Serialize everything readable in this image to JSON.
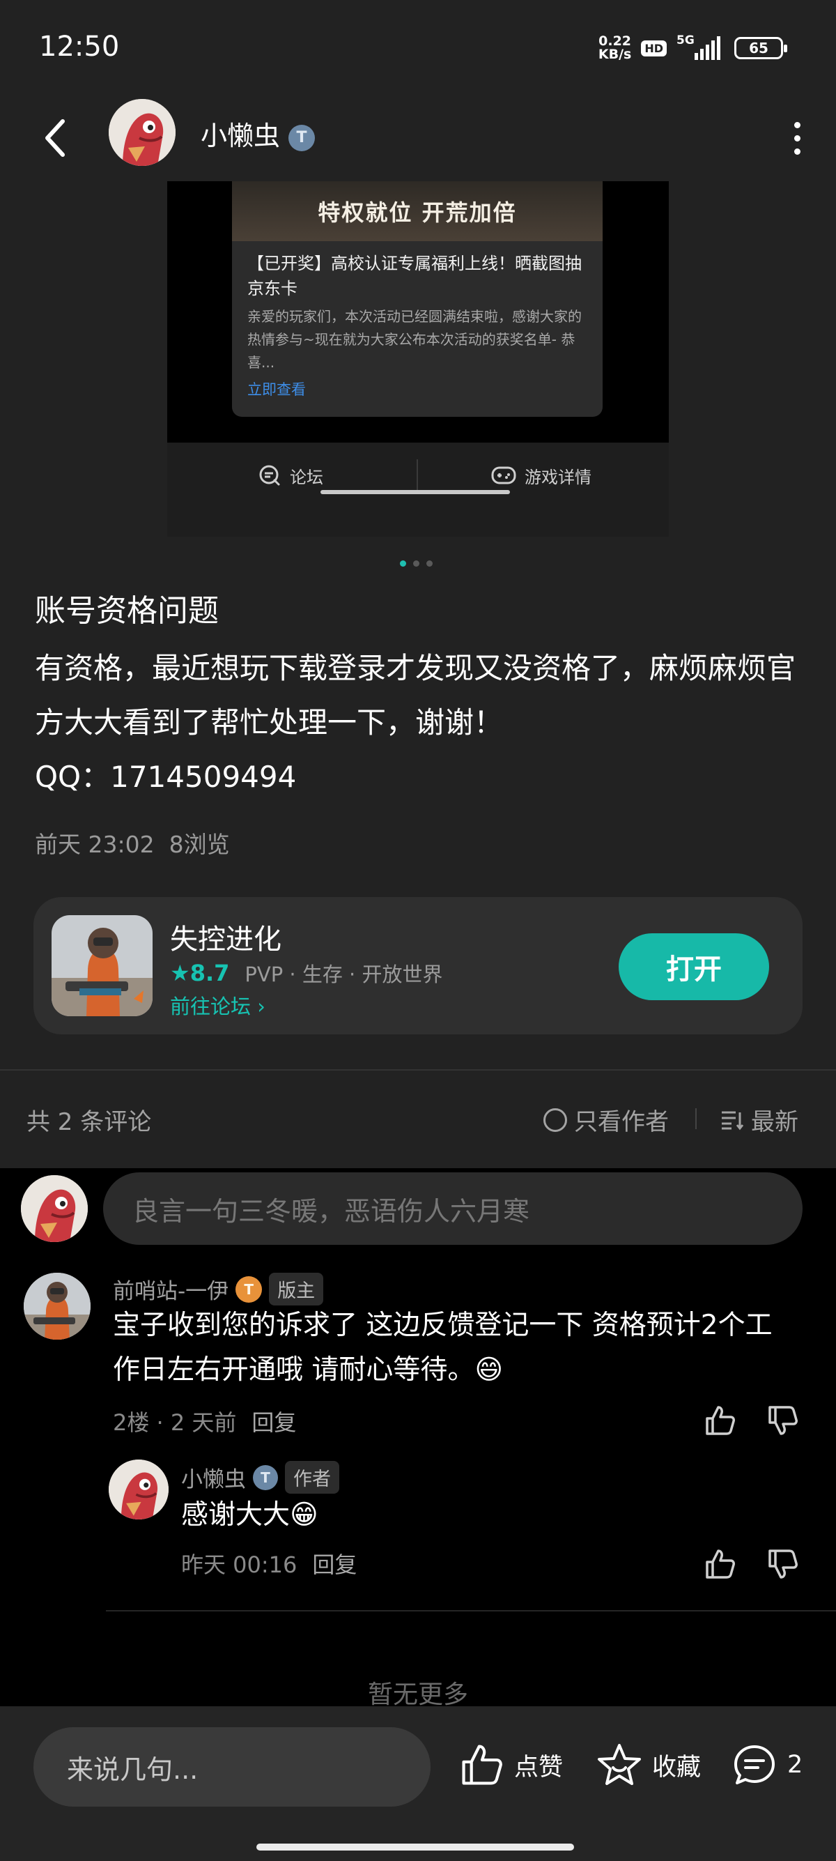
{
  "status_bar": {
    "time": "12:50",
    "net_speed_value": "0.22",
    "net_speed_unit": "KB/s",
    "hd": "HD",
    "network": "5G",
    "battery": "65"
  },
  "header": {
    "username": "小懒虫",
    "verify_badge": "T"
  },
  "post_image": {
    "banner_text": "特权就位 开荒加倍",
    "card_title": "【已开奖】高校认证专属福利上线！晒截图抽京东卡",
    "card_body": "亲爱的玩家们，本次活动已经圆满结束啦，感谢大家的热情参与~现在就为大家公布本次活动的获奖名单- 恭喜...",
    "card_link": "立即查看",
    "tab_forum": "论坛",
    "tab_game_detail": "游戏详情"
  },
  "post": {
    "title": "账号资格问题",
    "body": "有资格，最近想玩下载登录才发现又没资格了，麻烦麻烦官方大大看到了帮忙处理一下，谢谢！",
    "qq": "QQ：1714509494",
    "time": "前天 23:02",
    "views": "8浏览"
  },
  "game_card": {
    "name": "失控进化",
    "rating": "8.7",
    "tags": "PVP · 生存 · 开放世界",
    "forum_link": "前往论坛",
    "open_button": "打开"
  },
  "comments_bar": {
    "count": "共 2 条评论",
    "author_only": "只看作者",
    "sort": "最新"
  },
  "comment_input": {
    "placeholder": "良言一句三冬暖，恶语伤人六月寒"
  },
  "comments": [
    {
      "name": "前哨站-一伊",
      "badge": "T",
      "role": "版主",
      "text": "宝子收到您的诉求了  这边反馈登记一下  资格预计2个工作日左右开通哦 请耐心等待。😄",
      "floor": "2楼 · 2 天前",
      "reply": "回复"
    },
    {
      "name": "小懒虫",
      "badge": "T",
      "role": "作者",
      "text": "感谢大大😁",
      "time": "昨天 00:16",
      "reply": "回复"
    }
  ],
  "no_more": "暂无更多",
  "bottom_bar": {
    "input_placeholder": "来说几句...",
    "like": "点赞",
    "favorite": "收藏",
    "comment_count": "2"
  },
  "colors": {
    "accent": "#17c3b2",
    "background": "#222222",
    "comments_bg": "#000000"
  }
}
